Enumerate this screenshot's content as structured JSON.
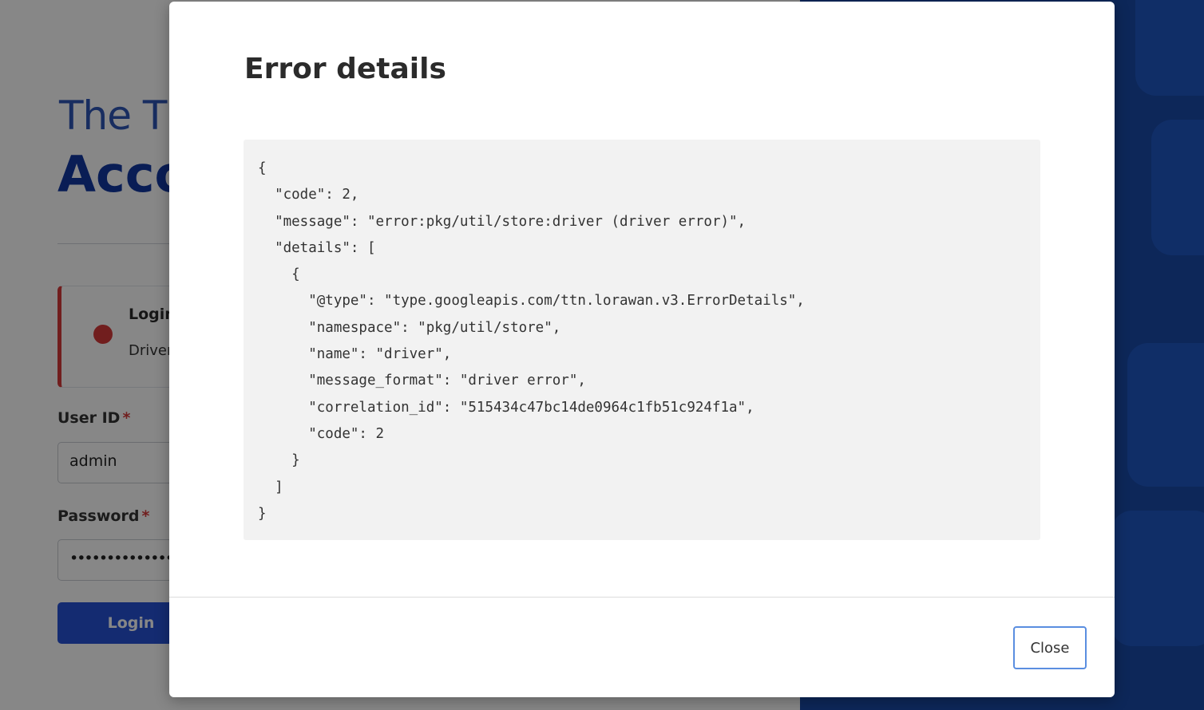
{
  "login_page": {
    "title_line1": "The Th",
    "title_line2": "Acco",
    "error": {
      "title": "Login",
      "message": "Driver"
    },
    "user_id": {
      "label": "User ID",
      "required_mark": "*",
      "value": "admin"
    },
    "password": {
      "label": "Password",
      "required_mark": "*",
      "value": "••••••••••••••"
    },
    "login_button": "Login"
  },
  "modal": {
    "title": "Error details",
    "code_lines": [
      "{",
      "  \"code\": 2,",
      "  \"message\": \"error:pkg/util/store:driver (driver error)\",",
      "  \"details\": [",
      "    {",
      "      \"@type\": \"type.googleapis.com/ttn.lorawan.v3.ErrorDetails\",",
      "      \"namespace\": \"pkg/util/store\",",
      "      \"name\": \"driver\",",
      "      \"message_format\": \"driver error\",",
      "      \"correlation_id\": \"515434c47bc14de0964c1fb51c924f1a\",",
      "      \"code\": 2",
      "    }",
      "  ]",
      "}"
    ],
    "close_button": "Close"
  },
  "colors": {
    "brand_blue": "#1237a0",
    "panel_blue": "#1a4aa8",
    "error_red": "#d63a3a",
    "button_blue": "#2752d6"
  }
}
